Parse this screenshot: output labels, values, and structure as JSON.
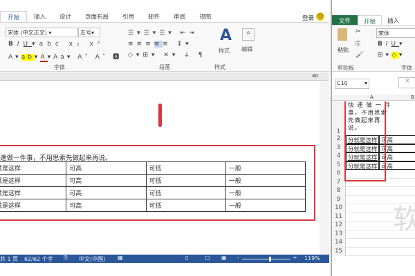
{
  "word": {
    "tabs": [
      "开始",
      "插入",
      "设计",
      "页面布局",
      "引用",
      "邮件",
      "审阅",
      "视图"
    ],
    "login": "登录",
    "font_name": "宋体 (中文正文)",
    "font_size": "五号",
    "groups": {
      "font": "字体",
      "paragraph": "段落",
      "styles": "样式"
    },
    "styles_button": "样式",
    "edit_button": "编辑",
    "ruler_mark": "40",
    "paragraph": "速做一件事，不用思索先做起来再说。",
    "table": [
      [
        "分就是这样",
        "可高",
        "可低",
        "一般"
      ],
      [
        "分就是这样",
        "可高",
        "可低",
        "一般"
      ],
      [
        "分就是这样",
        "可高",
        "可低",
        "一般"
      ],
      [
        "分就是这样",
        "可高",
        "可低",
        "一般"
      ]
    ],
    "status": {
      "page": "共 1 页",
      "words": "62/62 个字",
      "lang": "中文(中国)",
      "zoom": "119%",
      "zoom_level": 0.55
    }
  },
  "excel": {
    "tabs": [
      "文件",
      "开始",
      "插入"
    ],
    "paste": "粘贴",
    "clipboard": "剪贴板",
    "font_name": "宋体",
    "font_group": "字体",
    "name_box": "C10",
    "col_headers": [
      "A",
      "B"
    ],
    "cell_a1": "快 速 做 一 件 事，不用思索先做起来再说。",
    "rows": [
      [
        "分就是这样",
        "可高"
      ],
      [
        "分就是这样",
        "可高"
      ],
      [
        "分就是这样",
        "可高"
      ],
      [
        "分就是这样",
        "可高"
      ]
    ],
    "row_numbers": [
      "1",
      "2",
      "3",
      "4",
      "5",
      "6",
      "7",
      "8",
      "9",
      "10",
      "11",
      "12",
      "13",
      "14",
      "15"
    ],
    "watermark": "软"
  },
  "colors": {
    "word_blue": "#2b579a",
    "excel_green": "#217346",
    "highlight_red": "#d9363e"
  }
}
